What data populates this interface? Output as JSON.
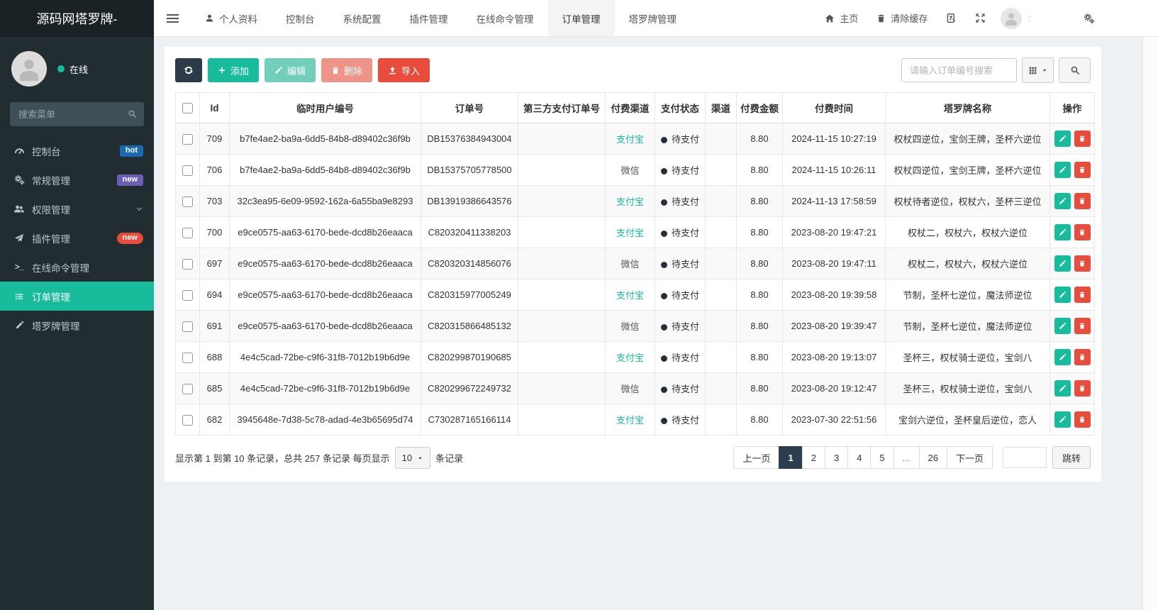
{
  "colors": {
    "accent": "#18bc9c",
    "navy": "#2c3e50",
    "danger": "#e74c3c",
    "badge_hot": "#1769b2",
    "badge_new_purple": "#6a5fb5",
    "badge_new_red": "#e74c3c",
    "sidebar_bg": "#222d32",
    "logo_bg": "#1a2226"
  },
  "sidebar": {
    "logo": "源码网塔罗牌-",
    "status": "在线",
    "search_placeholder": "搜索菜单",
    "menu": [
      {
        "label": "控制台",
        "icon": "tachometer",
        "badge": "hot",
        "badge_style": "blue"
      },
      {
        "label": "常规管理",
        "icon": "gears",
        "badge": "new",
        "badge_style": "purple"
      },
      {
        "label": "权限管理",
        "icon": "users",
        "chevron": true
      },
      {
        "label": "插件管理",
        "icon": "paper-plane",
        "badge": "new",
        "badge_style": "red"
      },
      {
        "label": "在线命令管理",
        "icon": "terminal"
      },
      {
        "label": "订单管理",
        "icon": "list",
        "active": true
      },
      {
        "label": "塔罗牌管理",
        "icon": "pen"
      }
    ]
  },
  "topnav": {
    "tabs": [
      {
        "label": "个人资料",
        "icon": "user"
      },
      {
        "label": "控制台"
      },
      {
        "label": "系统配置"
      },
      {
        "label": "插件管理"
      },
      {
        "label": "在线命令管理"
      },
      {
        "label": "订单管理",
        "active": true
      },
      {
        "label": "塔罗牌管理"
      }
    ],
    "right": {
      "home": "主页",
      "clear_cache": "清除缓存",
      "username": ":"
    }
  },
  "toolbar": {
    "add": "添加",
    "edit": "编辑",
    "delete": "删除",
    "import": "导入",
    "search_placeholder": "请输入订单编号搜索"
  },
  "table": {
    "headers": [
      "Id",
      "临时用户编号",
      "订单号",
      "第三方支付订单号",
      "付费渠道",
      "支付状态",
      "渠道",
      "付费金额",
      "付费时间",
      "塔罗牌名称",
      "操作"
    ],
    "rows": [
      {
        "id": "709",
        "user": "b7fe4ae2-ba9a-6dd5-84b8-d89402c36f9b",
        "order": "DB15376384943004",
        "third": "",
        "channel": "支付宝",
        "status": "待支付",
        "qudao": "",
        "amount": "8.80",
        "time": "2024-11-15 10:27:19",
        "tarot": "权杖四逆位，宝剑王牌，圣杯六逆位"
      },
      {
        "id": "706",
        "user": "b7fe4ae2-ba9a-6dd5-84b8-d89402c36f9b",
        "order": "DB15375705778500",
        "third": "",
        "channel": "微信",
        "status": "待支付",
        "qudao": "",
        "amount": "8.80",
        "time": "2024-11-15 10:26:11",
        "tarot": "权杖四逆位，宝剑王牌，圣杯六逆位"
      },
      {
        "id": "703",
        "user": "32c3ea95-6e09-9592-162a-6a55ba9e8293",
        "order": "DB13919386643576",
        "third": "",
        "channel": "支付宝",
        "status": "待支付",
        "qudao": "",
        "amount": "8.80",
        "time": "2024-11-13 17:58:59",
        "tarot": "权杖待者逆位，权杖六，圣杯三逆位"
      },
      {
        "id": "700",
        "user": "e9ce0575-aa63-6170-bede-dcd8b26eaaca",
        "order": "C820320411338203",
        "third": "",
        "channel": "支付宝",
        "status": "待支付",
        "qudao": "",
        "amount": "8.80",
        "time": "2023-08-20 19:47:21",
        "tarot": "权杖二，权杖六，权杖六逆位"
      },
      {
        "id": "697",
        "user": "e9ce0575-aa63-6170-bede-dcd8b26eaaca",
        "order": "C820320314856076",
        "third": "",
        "channel": "微信",
        "status": "待支付",
        "qudao": "",
        "amount": "8.80",
        "time": "2023-08-20 19:47:11",
        "tarot": "权杖二，权杖六，权杖六逆位"
      },
      {
        "id": "694",
        "user": "e9ce0575-aa63-6170-bede-dcd8b26eaaca",
        "order": "C820315977005249",
        "third": "",
        "channel": "支付宝",
        "status": "待支付",
        "qudao": "",
        "amount": "8.80",
        "time": "2023-08-20 19:39:58",
        "tarot": "节制，圣杯七逆位，魔法师逆位"
      },
      {
        "id": "691",
        "user": "e9ce0575-aa63-6170-bede-dcd8b26eaaca",
        "order": "C820315866485132",
        "third": "",
        "channel": "微信",
        "status": "待支付",
        "qudao": "",
        "amount": "8.80",
        "time": "2023-08-20 19:39:47",
        "tarot": "节制，圣杯七逆位，魔法师逆位"
      },
      {
        "id": "688",
        "user": "4e4c5cad-72be-c9f6-31f8-7012b19b6d9e",
        "order": "C820299870190685",
        "third": "",
        "channel": "支付宝",
        "status": "待支付",
        "qudao": "",
        "amount": "8.80",
        "time": "2023-08-20 19:13:07",
        "tarot": "圣杯三，权杖骑士逆位，宝剑八"
      },
      {
        "id": "685",
        "user": "4e4c5cad-72be-c9f6-31f8-7012b19b6d9e",
        "order": "C820299672249732",
        "third": "",
        "channel": "微信",
        "status": "待支付",
        "qudao": "",
        "amount": "8.80",
        "time": "2023-08-20 19:12:47",
        "tarot": "圣杯三，权杖骑士逆位，宝剑八"
      },
      {
        "id": "682",
        "user": "3945648e-7d38-5c78-adad-4e3b65695d74",
        "order": "C730287165166114",
        "third": "",
        "channel": "支付宝",
        "status": "待支付",
        "qudao": "",
        "amount": "8.80",
        "time": "2023-07-30 22:51:56",
        "tarot": "宝剑六逆位，圣杯皇后逆位，恋人"
      }
    ]
  },
  "pagination": {
    "info_prefix": "显示第 1 到第 10 条记录，总共 257 条记录 每页显示",
    "page_size": "10",
    "info_suffix": "条记录",
    "pages": [
      "上一页",
      "1",
      "2",
      "3",
      "4",
      "5",
      "...",
      "26",
      "下一页"
    ],
    "active_page": "1",
    "jump_label": "跳转"
  }
}
